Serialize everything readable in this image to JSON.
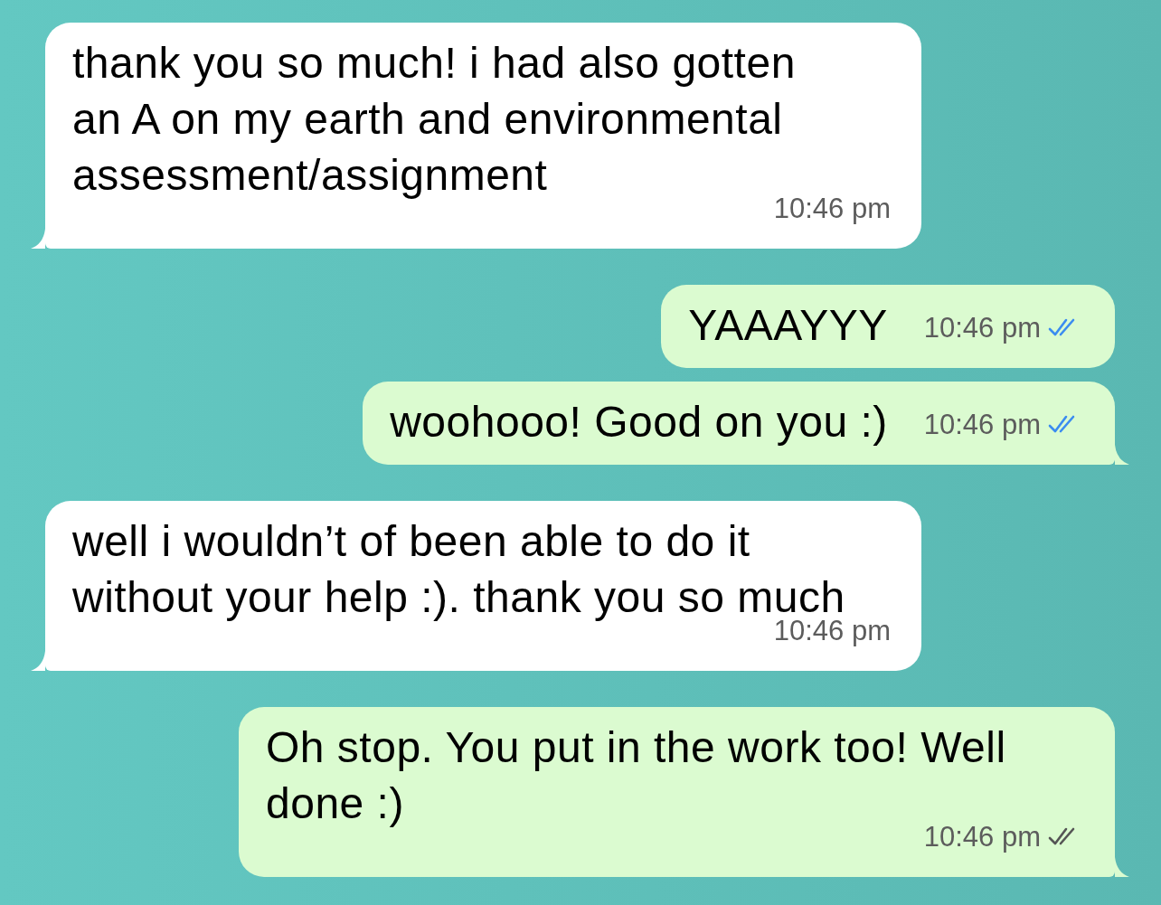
{
  "messages": [
    {
      "kind": "incoming",
      "text": "thank you so much! i had also gotten an A on my earth and environmental assessment/assignment",
      "time": "10:46 pm",
      "tail": true
    },
    {
      "kind": "outgoing",
      "text": "YAAAYYY",
      "time": "10:46 pm",
      "tail": false,
      "read": true
    },
    {
      "kind": "outgoing",
      "text": "woohooo! Good on you :)",
      "time": "10:46 pm",
      "tail": true,
      "read": true
    },
    {
      "kind": "incoming",
      "text": "well i wouldn’t of been able to do it without your help :). thank you so much",
      "time": "10:46 pm",
      "tail": true
    },
    {
      "kind": "outgoing",
      "text": "Oh stop. You put in the work too! Well done :)",
      "time": "10:46 pm",
      "tail": true,
      "read": false
    }
  ]
}
